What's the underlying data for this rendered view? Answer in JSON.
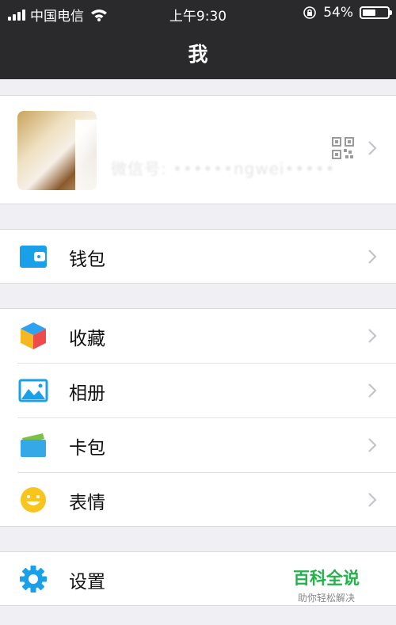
{
  "status_bar": {
    "carrier": "中国电信",
    "time": "上午9:30",
    "battery": "54%",
    "battery_level": 0.54
  },
  "nav": {
    "title": "我"
  },
  "profile": {
    "blurred_id": "微信号: ••••••ngwei•••••"
  },
  "menu": {
    "wallet": {
      "label": "钱包",
      "icon": "wallet-icon"
    },
    "favorites": {
      "label": "收藏",
      "icon": "cube-icon"
    },
    "album": {
      "label": "相册",
      "icon": "photo-icon"
    },
    "cards": {
      "label": "卡包",
      "icon": "card-icon"
    },
    "stickers": {
      "label": "表情",
      "icon": "smile-icon"
    },
    "settings": {
      "label": "设置",
      "icon": "gear-icon"
    }
  },
  "watermark": {
    "title": "百科全说",
    "subtitle": "助你轻松解决"
  },
  "colors": {
    "nav_bg": "#2a2a2c",
    "page_bg": "#efeff4",
    "accent_blue": "#1aa0e8",
    "watermark_green": "#21b34a"
  }
}
